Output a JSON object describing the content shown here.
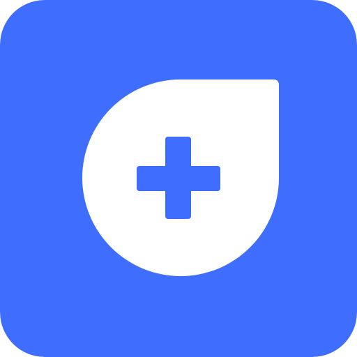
{
  "icon": {
    "name": "app-icon",
    "glyph": "plus-in-drop-icon",
    "colors": {
      "background": "#3F6DFD",
      "drop": "#FFFFFF",
      "plus": "#3F6DFD"
    }
  }
}
